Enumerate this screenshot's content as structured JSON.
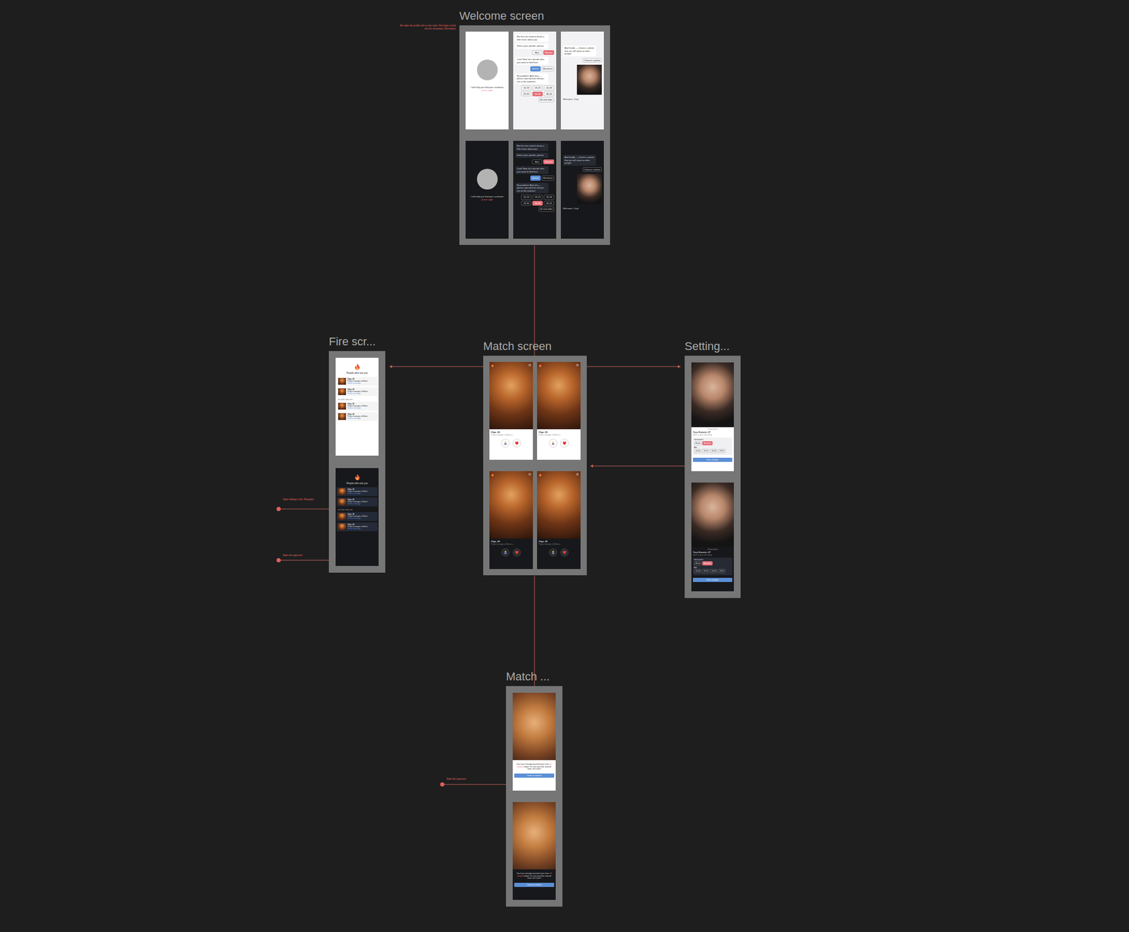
{
  "canvas_note": "We asks the profile info on the start / first login to find out the necessary information",
  "welcome": {
    "title": "Welcome screen",
    "variants": [
      {
        "theme": "light"
      },
      {
        "theme": "dark"
      }
    ],
    "intro": {
      "text": "I will help you find your soulmate",
      "accent": "at first sight"
    },
    "quiz": {
      "intro": "But first we need to know a little more about you",
      "gender_q": "Select your gender, please",
      "genders": [
        {
          "label": "Man",
          "selected": false
        },
        {
          "label": "Woman",
          "selected": true
        }
      ],
      "target_q": "Cool! Now let's decide who you want to find here",
      "targets": [
        {
          "label": "A man",
          "selected": true
        },
        {
          "label": "A woman",
          "selected": false
        }
      ],
      "age_q": "No problem! And also — please specify how old you are at the moment",
      "ages": [
        {
          "label": "14-18",
          "selected": false
        },
        {
          "label": "19-23",
          "selected": false
        },
        {
          "label": "24-28",
          "selected": false
        },
        {
          "label": "29-33",
          "selected": false
        },
        {
          "label": "34-38",
          "selected": true
        },
        {
          "label": "39-43",
          "selected": false
        },
        {
          "label": "44 and older",
          "selected": false
        }
      ]
    },
    "photo": {
      "text": "And finally — choose a photo that we will show to other people",
      "button": "Choose a photo",
      "welcome": "Welcome, Yury!"
    }
  },
  "fire": {
    "title": "Fire scr...",
    "variants": [
      {
        "theme": "light"
      },
      {
        "theme": "dark"
      }
    ],
    "heading": "People who suit you",
    "divider": "SHOWED EARLIER",
    "people": [
      {
        "name": "Olga, 26",
        "role": "Project manager at Miami",
        "action": "Send a message"
      },
      {
        "name": "Olga, 26",
        "role": "Project manager at Miami",
        "action": "Send a message"
      },
      {
        "name": "Olga, 26",
        "role": "Project manager at Miami",
        "action": "Send a message"
      },
      {
        "name": "Olga, 26",
        "role": "Project manager at Miami",
        "action": "Send a message"
      }
    ]
  },
  "match": {
    "title": "Match screen",
    "variants": [
      {
        "theme": "light"
      },
      {
        "theme": "dark"
      }
    ],
    "cards": [
      {
        "name": "Olga, 26",
        "role": "Project manager at Miami a..."
      },
      {
        "name": "Olga, 26",
        "role": "Project manager at Miami a..."
      }
    ]
  },
  "settings": {
    "title": "Setting...",
    "variants": [
      {
        "theme": "light"
      },
      {
        "theme": "dark"
      }
    ],
    "change_photo": "Change photo",
    "name": "Yury Kuzmin, 27",
    "bio": "Work in sport, like hiking",
    "interest_label": "Interested in",
    "targets": [
      {
        "label": "A man",
        "selected": false
      },
      {
        "label": "A woman",
        "selected": true
      }
    ],
    "age_label": "Age",
    "ages": [
      {
        "label": "14-18",
        "selected": false
      },
      {
        "label": "19-23",
        "selected": false
      },
      {
        "label": "24-28",
        "selected": false
      },
      {
        "label": "29-33",
        "selected": false
      }
    ],
    "save": "Save changes"
  },
  "limit": {
    "title": "Match ...",
    "variants": [
      {
        "theme": "light"
      },
      {
        "theme": "dark"
      }
    ],
    "before": "You have already watched more than ",
    "highlight": "10 people",
    "after": " today! I'm sure you'll be noticed soon, let's wait?",
    "button": "I want to continue"
  },
  "annotations": [
    {
      "text": "Open dialog in the Telegram"
    },
    {
      "text": "Start the payment"
    },
    {
      "text": "Start the payment"
    }
  ]
}
